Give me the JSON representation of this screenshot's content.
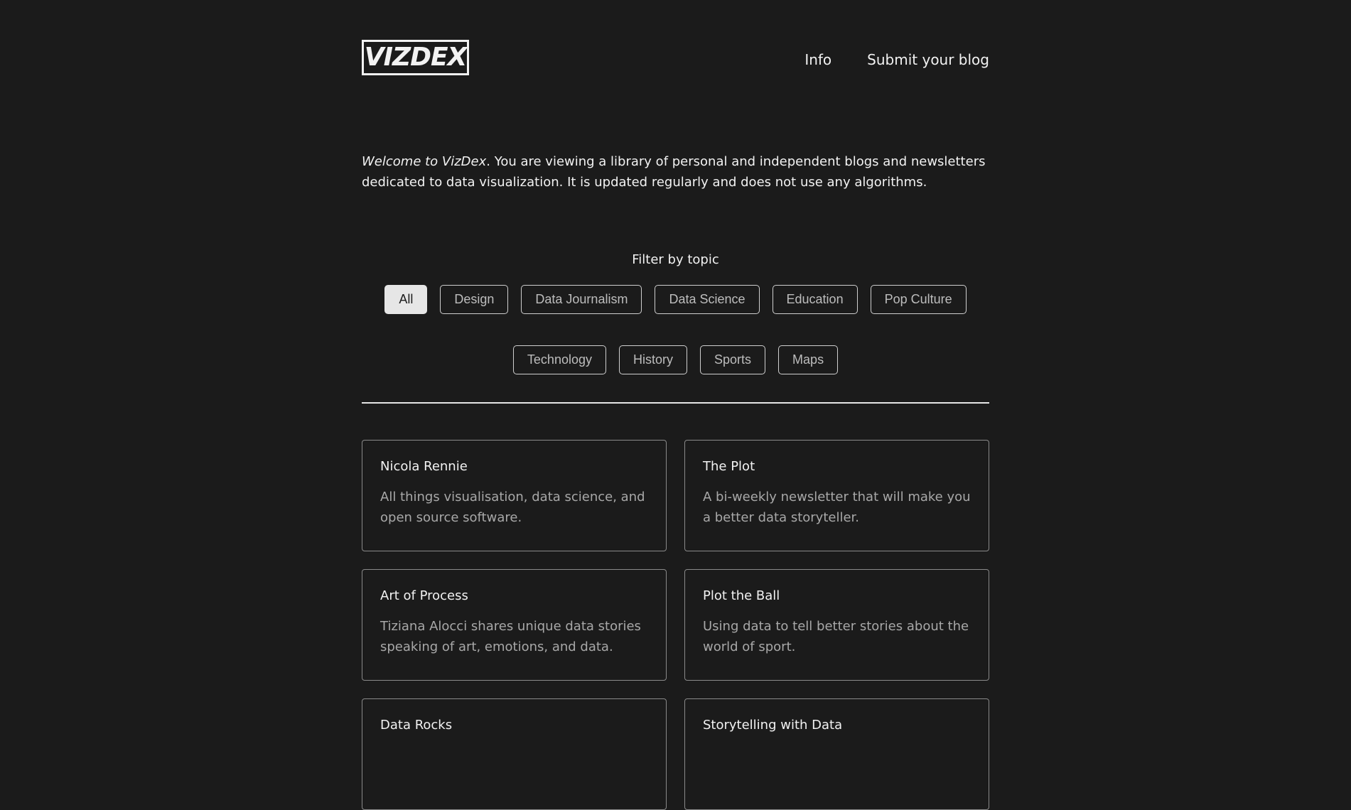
{
  "header": {
    "logo_text": "VIZDEX",
    "nav": [
      {
        "label": "Info"
      },
      {
        "label": "Submit your blog"
      }
    ]
  },
  "intro": {
    "welcome_italic": "Welcome to VizDex",
    "welcome_rest": ". You are viewing a library of personal and independent blogs and newsletters dedicated to data visualization. It is updated regularly and does not use any algorithms."
  },
  "filters": {
    "title": "Filter by topic",
    "selected": "All",
    "topics": [
      "All",
      "Design",
      "Data Journalism",
      "Data Science",
      "Education",
      "Pop Culture",
      "Technology",
      "History",
      "Sports",
      "Maps"
    ]
  },
  "blogs": [
    {
      "title": "Nicola Rennie",
      "description": "All things visualisation, data science, and open source software."
    },
    {
      "title": "The Plot",
      "description": "A bi-weekly newsletter that will make you a better data storyteller."
    },
    {
      "title": "Art of Process",
      "description": "Tiziana Alocci shares unique data stories speaking of art, emotions, and data."
    },
    {
      "title": "Plot the Ball",
      "description": "Using data to tell better stories about the world of sport."
    },
    {
      "title": "Data Rocks",
      "description": ""
    },
    {
      "title": "Storytelling with Data",
      "description": ""
    }
  ],
  "colors": {
    "background": "#1b1b1b",
    "text": "#f2f2f2",
    "muted_text": "#a8a8a8",
    "active_chip_bg": "#e6e6e6"
  }
}
